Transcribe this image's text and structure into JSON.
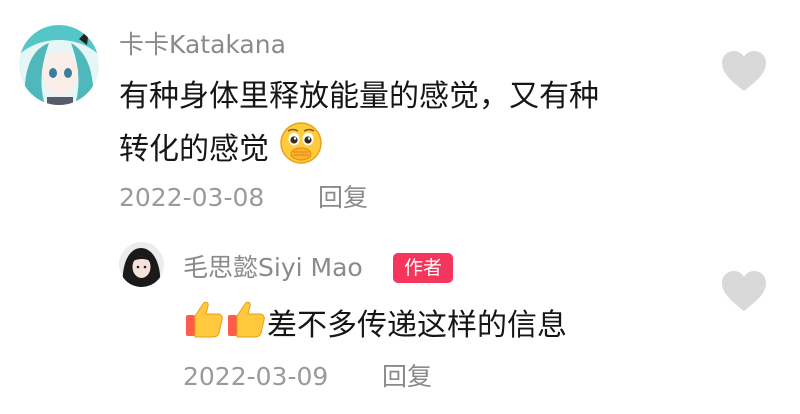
{
  "comment": {
    "username": "卡卡Katakana",
    "text_line1": "有种身体里释放能量的感觉，又有种",
    "text_line2": "转化的感觉",
    "date": "2022-03-08",
    "reply_label": "回复"
  },
  "reply": {
    "username": "毛思懿Siyi Mao",
    "author_badge": "作者",
    "text": "差不多传递这样的信息",
    "date": "2022-03-09",
    "reply_label": "回复"
  },
  "colors": {
    "badge": "#f5365c",
    "heart": "#d9d9d9",
    "username": "#8a8a8a",
    "text": "#161616",
    "meta": "#9a9a9a"
  },
  "icons": {
    "comment_emoji": "pleading-face-covering-mouth-icon",
    "reply_emoji": "thumbs-up-icon",
    "like": "heart-icon"
  }
}
